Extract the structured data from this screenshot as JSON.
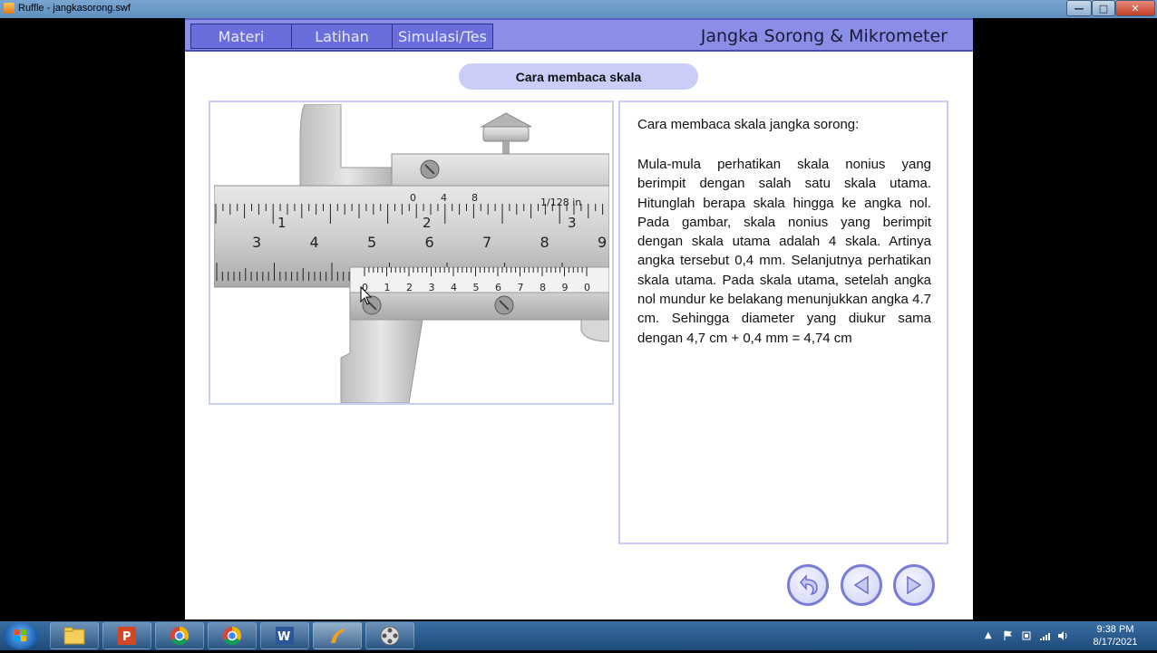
{
  "window": {
    "title": "Ruffle - jangkasorong.swf"
  },
  "nav": {
    "tabs": [
      {
        "label": "Materi"
      },
      {
        "label": "Latihan"
      },
      {
        "label": "Simulasi/Tes"
      }
    ],
    "app_title": "Jangka Sorong & Mikrometer"
  },
  "section": {
    "title": "Cara membaca skala"
  },
  "caliper": {
    "main_scale_cm": [
      "3",
      "4",
      "5",
      "6",
      "7",
      "8",
      "9"
    ],
    "inch_scale": [
      "1",
      "2",
      "3"
    ],
    "nonius_scale": [
      "0",
      "1",
      "2",
      "3",
      "4",
      "5",
      "6",
      "7",
      "8",
      "9",
      "0"
    ],
    "inch_nonius": [
      "0",
      "4",
      "8"
    ],
    "inch_unit_label": "1/128 in"
  },
  "content": {
    "heading": "Cara membaca skala jangka sorong:",
    "body": "Mula-mula perhatikan skala nonius yang berimpit dengan salah satu skala utama. Hitunglah berapa skala hingga ke angka nol. Pada gambar, skala nonius yang berimpit dengan skala utama adalah 4 skala. Artinya angka tersebut 0,4 mm. Selanjutnya perhatikan skala utama. Pada skala utama, setelah angka nol mundur ke belakang menunjukkan angka 4.7 cm. Sehingga diameter yang diukur sama dengan 4,7 cm + 0,4 mm = 4,74 cm"
  },
  "controls": {
    "back_icon": "return-arrow-icon",
    "prev_icon": "triangle-left-icon",
    "next_icon": "triangle-right-icon"
  },
  "taskbar": {
    "items": [
      "file-explorer-icon",
      "powerpoint-icon",
      "chrome-icon",
      "chrome-icon",
      "word-icon",
      "ruffle-icon",
      "media-icon"
    ],
    "time": "9:38 PM",
    "date": "8/17/2021"
  },
  "colors": {
    "accent": "#8b8ee6",
    "panel_border": "#c9cdf7",
    "tab_fill": "#6a6edc"
  }
}
